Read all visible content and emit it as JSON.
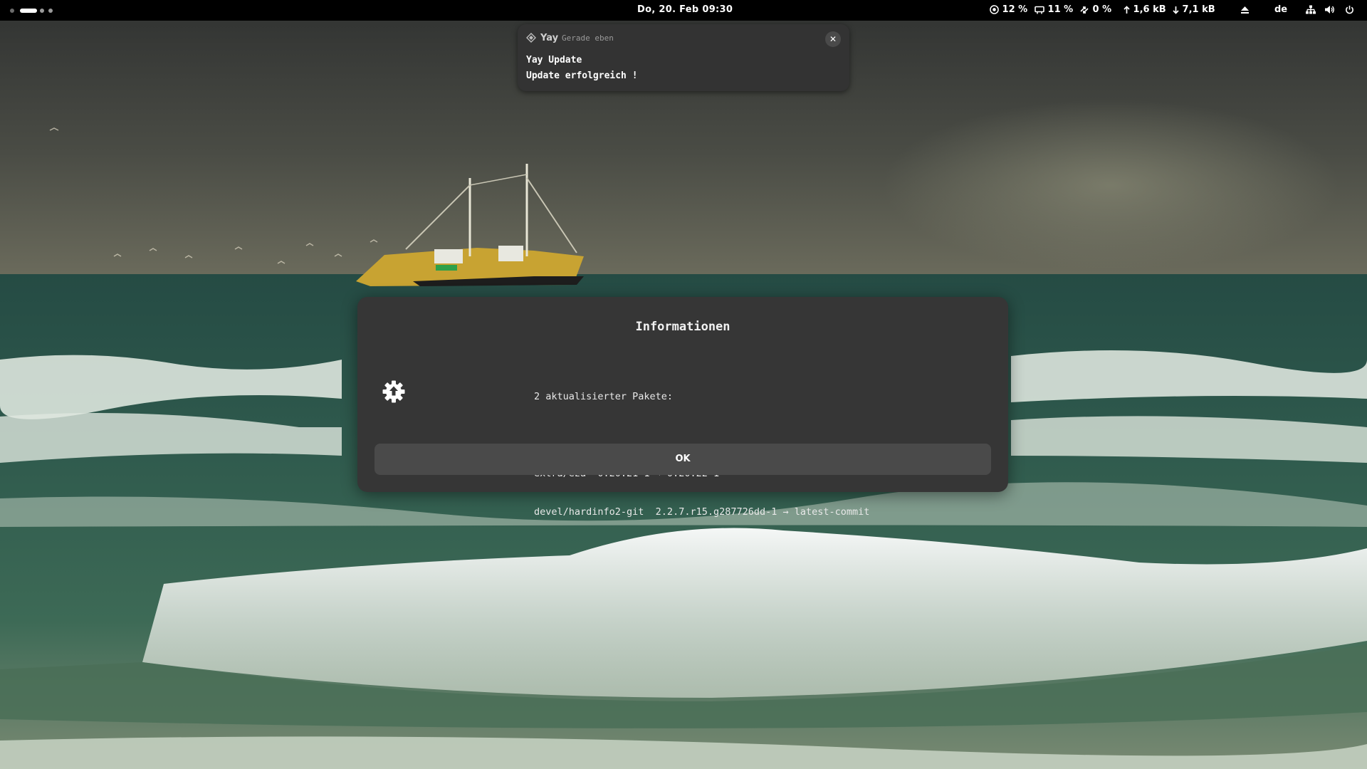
{
  "topbar": {
    "clock": "Do, 20. Feb 09:30",
    "cpu": "12 %",
    "memory": "11 %",
    "swap": "0 %",
    "net_up": "1,6 kB",
    "net_down": "7,1 kB",
    "keyboard_layout": "de",
    "icons": [
      "cpu-icon",
      "memory-icon",
      "swap-icon",
      "upload-arrow-icon",
      "download-arrow-icon",
      "eject-icon",
      "network-icon",
      "volume-icon",
      "power-icon"
    ]
  },
  "notification": {
    "app": "Yay",
    "time": "Gerade eben",
    "title": "Yay Update",
    "body": "Update erfolgreich !",
    "close_glyph": "✕"
  },
  "dialog": {
    "title": "Informationen",
    "summary": "2 aktualisierter Pakete:",
    "packages": [
      "extra/eza  0.20.21-1 → 0.20.22-1",
      "devel/hardinfo2-git  2.2.7.r15.g287726dd-1 → latest-commit"
    ],
    "ok_label": "OK",
    "icon": "update-gear-icon"
  },
  "colors": {
    "panel": "#000000",
    "dialog_bg": "#363636",
    "button_bg": "#4a4a4a",
    "notification_bg": "#333333"
  }
}
